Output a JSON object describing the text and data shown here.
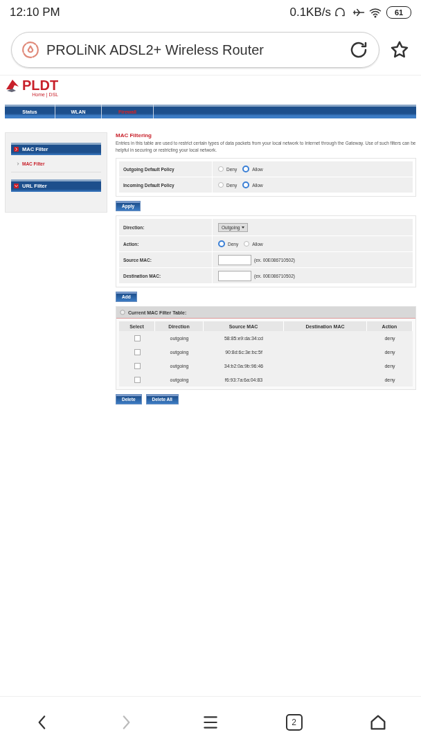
{
  "status_bar": {
    "time": "12:10 PM",
    "speed": "0.1KB/s",
    "battery": "61"
  },
  "address_bar": {
    "title": "PROLiNK ADSL2+ Wireless Router"
  },
  "logo": {
    "brand": "PLDT",
    "subtitle": "Home | DSL"
  },
  "nav_tabs": [
    {
      "label": "Status",
      "selected": false
    },
    {
      "label": "WLAN",
      "selected": false
    },
    {
      "label": "Firewall",
      "selected": true
    }
  ],
  "sidebar": [
    {
      "label": "MAC Filter",
      "expanded": true,
      "children": [
        {
          "label": "MAC Filter",
          "selected": true
        }
      ]
    },
    {
      "label": "URL Filter",
      "expanded": false
    }
  ],
  "content": {
    "title": "MAC Filtering",
    "description": "Entries in this table are used to restrict certain types of data packets from your local network to Internet through the Gateway. Use of such filters can be helpful in securing or restricting your local network.",
    "policies": [
      {
        "label": "Outgoing Default Policy",
        "options": [
          {
            "label": "Deny",
            "selected": false
          },
          {
            "label": "Allow",
            "selected": true
          }
        ]
      },
      {
        "label": "Incoming Default Policy",
        "options": [
          {
            "label": "Deny",
            "selected": false
          },
          {
            "label": "Allow",
            "selected": true
          }
        ]
      }
    ],
    "apply_button": "Apply",
    "form": [
      {
        "kind": "select",
        "label": "Direction:",
        "value": "Outgoing"
      },
      {
        "kind": "radio",
        "label": "Action:",
        "options": [
          {
            "label": "Deny",
            "selected": true
          },
          {
            "label": "Allow",
            "selected": false
          }
        ]
      },
      {
        "kind": "input",
        "label": "Source MAC:",
        "hint": "(ex. 00E086710502)"
      },
      {
        "kind": "input",
        "label": "Destination MAC:",
        "hint": "(ex. 00E086710502)"
      }
    ],
    "add_button": "Add",
    "table": {
      "title": "Current MAC Filter Table:",
      "columns": [
        "Select",
        "Direction",
        "Source MAC",
        "Destination MAC",
        "Action"
      ],
      "rows": [
        {
          "checked": false,
          "direction": "outgoing",
          "source_mac": "58:85:e9:da:34:cd",
          "action": "deny"
        },
        {
          "checked": false,
          "direction": "outgoing",
          "source_mac": "90:8d:6c:3e:bc:5f",
          "action": "deny"
        },
        {
          "checked": false,
          "direction": "outgoing",
          "source_mac": "34:b2:0a:9b:96:46",
          "action": "deny"
        },
        {
          "checked": false,
          "direction": "outgoing",
          "source_mac": "f6:93:7a:6a:04:83",
          "action": "deny"
        }
      ]
    },
    "buttons": [
      "Delete",
      "Delete All"
    ]
  },
  "bottom_nav": {
    "tab_count": "2"
  }
}
